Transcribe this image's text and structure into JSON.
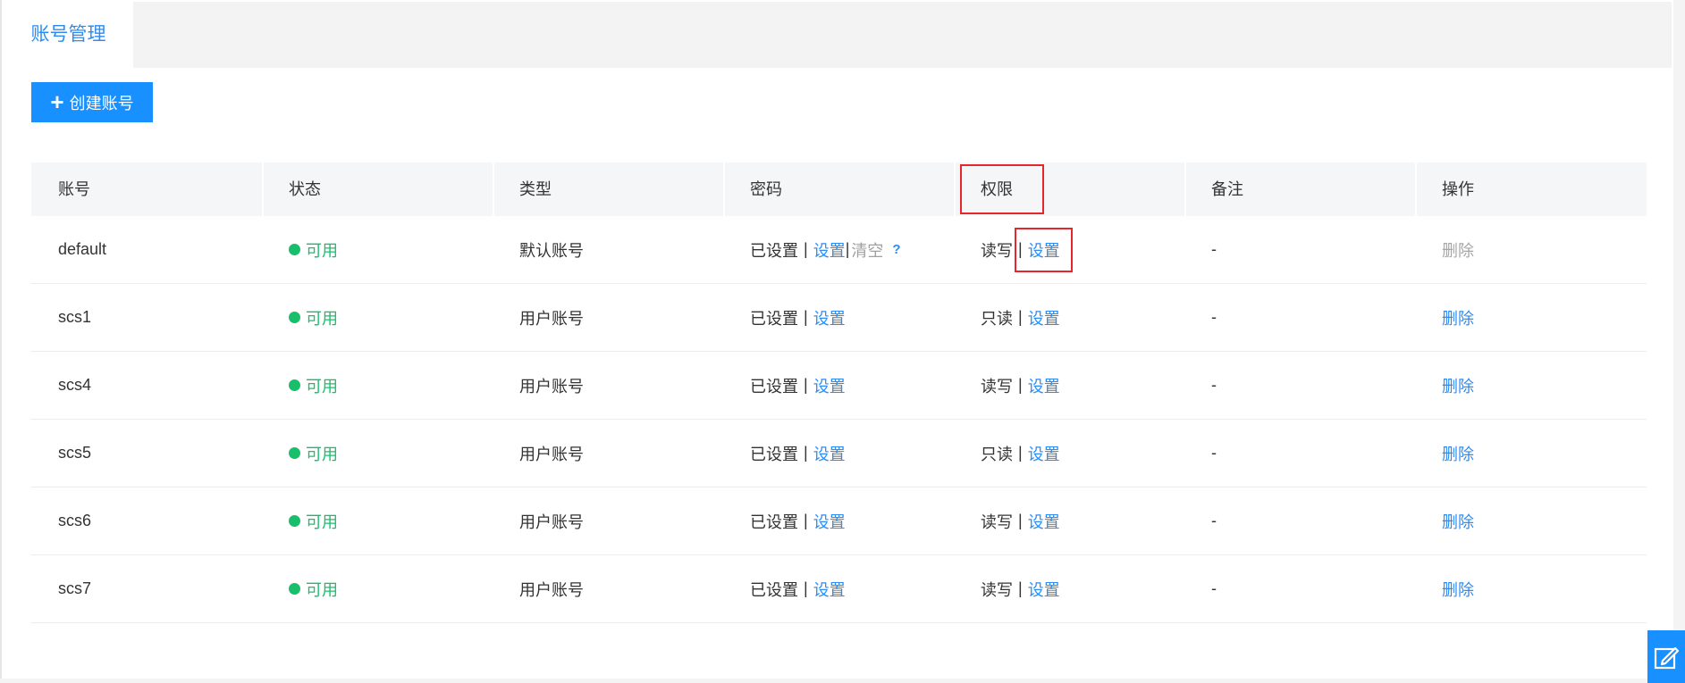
{
  "tab": {
    "label": "账号管理"
  },
  "toolbar": {
    "create_label": "创建账号"
  },
  "table": {
    "headers": [
      "账号",
      "状态",
      "类型",
      "密码",
      "权限",
      "备注",
      "操作"
    ],
    "rows": [
      {
        "account": "default",
        "status": "可用",
        "type": "默认账号",
        "password": "已设置",
        "password_set": "设置",
        "password_clear": "清空",
        "help": "?",
        "permission": "读写",
        "permission_set": "设置",
        "note": "-",
        "action": "删除"
      },
      {
        "account": "scs1",
        "status": "可用",
        "type": "用户账号",
        "password": "已设置",
        "password_set": "设置",
        "permission": "只读",
        "permission_set": "设置",
        "note": "-",
        "action": "删除"
      },
      {
        "account": "scs4",
        "status": "可用",
        "type": "用户账号",
        "password": "已设置",
        "password_set": "设置",
        "permission": "读写",
        "permission_set": "设置",
        "note": "-",
        "action": "删除"
      },
      {
        "account": "scs5",
        "status": "可用",
        "type": "用户账号",
        "password": "已设置",
        "password_set": "设置",
        "permission": "只读",
        "permission_set": "设置",
        "note": "-",
        "action": "删除"
      },
      {
        "account": "scs6",
        "status": "可用",
        "type": "用户账号",
        "password": "已设置",
        "password_set": "设置",
        "permission": "读写",
        "permission_set": "设置",
        "note": "-",
        "action": "删除"
      },
      {
        "account": "scs7",
        "status": "可用",
        "type": "用户账号",
        "password": "已设置",
        "password_set": "设置",
        "permission": "读写",
        "permission_set": "设置",
        "note": "-",
        "action": "删除"
      }
    ]
  },
  "separator": "|",
  "icons": {
    "create": "plus-icon",
    "status": "status-dot-icon",
    "help": "help-icon",
    "float_button": "edit-icon"
  },
  "colors": {
    "primary": "#1890ff",
    "link": "#2d8cf0",
    "success": "#19be6b",
    "highlight": "#e5262b"
  }
}
